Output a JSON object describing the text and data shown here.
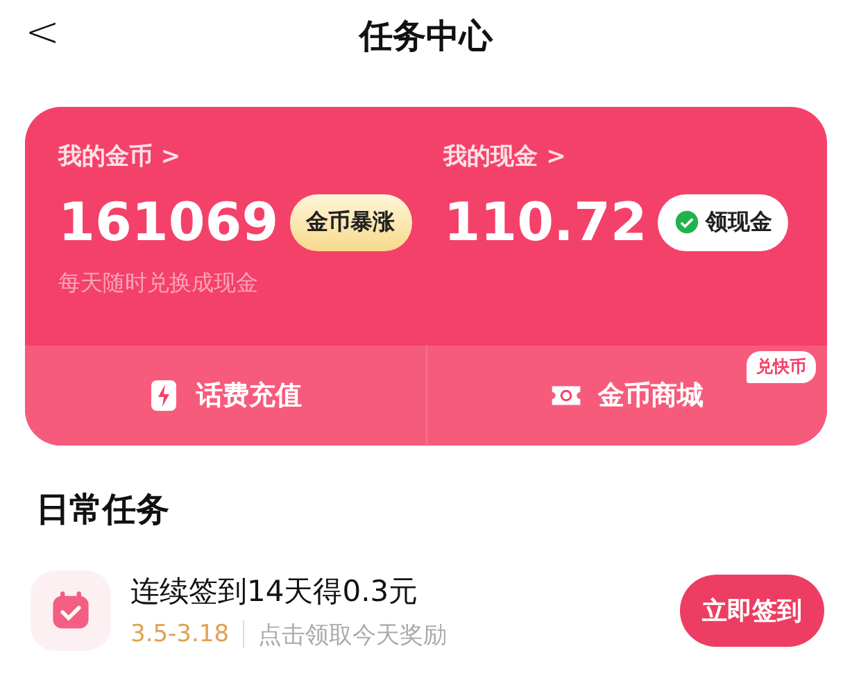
{
  "header": {
    "back": "<",
    "title": "任务中心"
  },
  "wallet": {
    "coins": {
      "label": "我的金币 >",
      "value": "161069",
      "badge": "金币暴涨",
      "hint": "每天随时兑换成现金"
    },
    "cash": {
      "label": "我的现金 >",
      "value": "110.72",
      "button": "领现金"
    },
    "actions": [
      {
        "kind": "phone",
        "label": "话费充值"
      },
      {
        "kind": "shop",
        "label": "金币商城",
        "tag": "兑快币"
      }
    ]
  },
  "section_title": "日常任务",
  "tasks": [
    {
      "title": "连续签到14天得0.3元",
      "dates": "3.5-3.18",
      "note": "点击领取今天奖励",
      "button": "立即签到"
    }
  ]
}
